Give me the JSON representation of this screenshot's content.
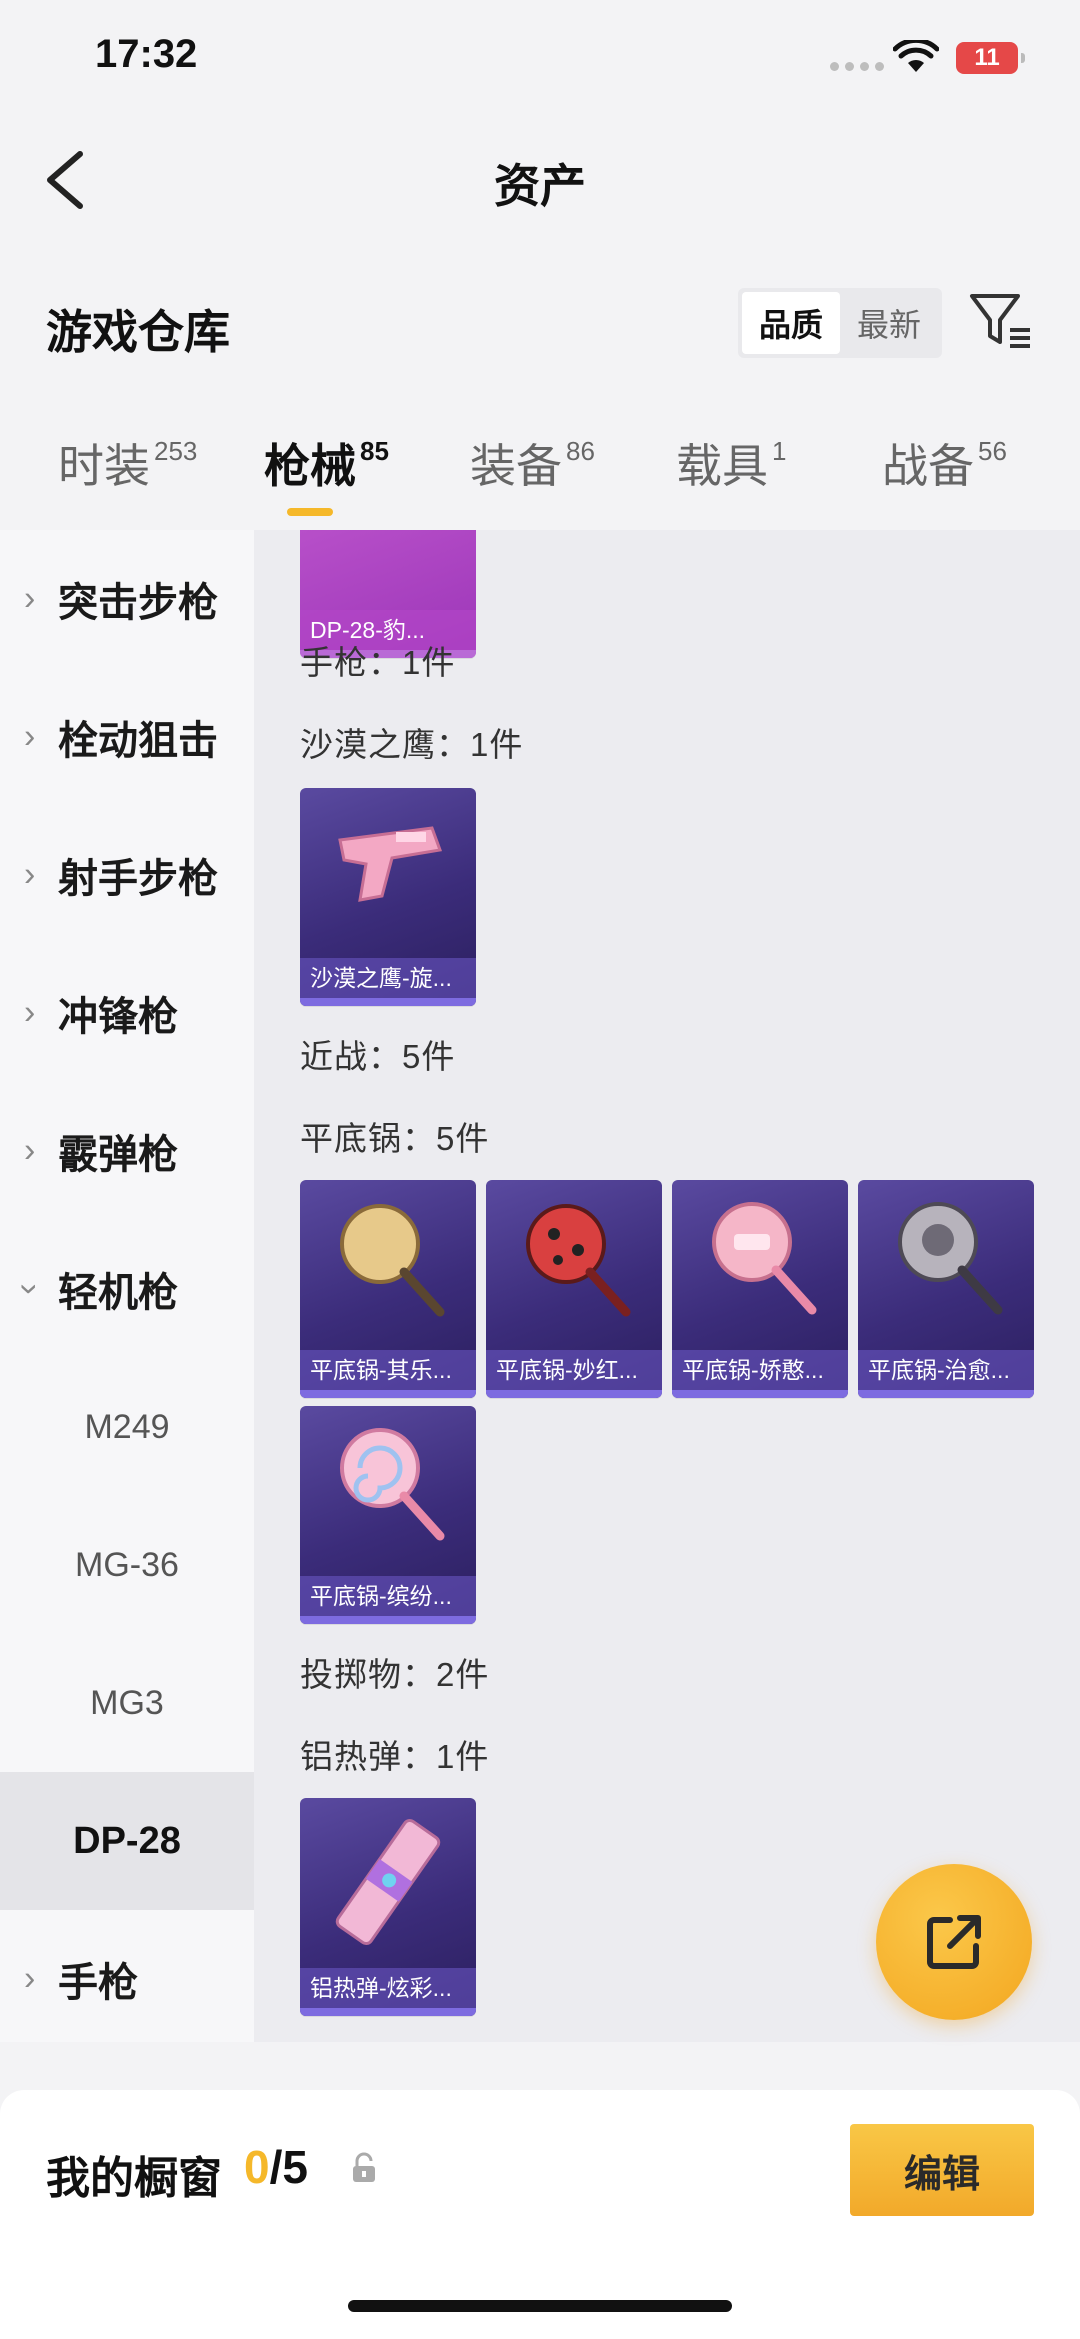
{
  "status": {
    "time": "17:32",
    "battery": "11"
  },
  "nav": {
    "title": "资产"
  },
  "warehouse": {
    "title": "游戏仓库",
    "sort_options": [
      "品质",
      "最新"
    ],
    "sort_selected": "品质"
  },
  "tabs": [
    {
      "label": "时装",
      "count": "253"
    },
    {
      "label": "枪械",
      "count": "85"
    },
    {
      "label": "装备",
      "count": "86"
    },
    {
      "label": "载具",
      "count": "1"
    },
    {
      "label": "战备",
      "count": "56"
    }
  ],
  "active_tab": "枪械",
  "sidebar": {
    "categories": [
      "突击步枪",
      "栓动狙击",
      "射手步枪",
      "冲锋枪",
      "霰弹枪",
      "轻机枪"
    ],
    "subitems": [
      "M249",
      "MG-36",
      "MG3",
      "DP-28"
    ],
    "selected_sub": "DP-28",
    "last_category": "手枪"
  },
  "content": {
    "top_card": "DP-28-豹...",
    "pistol_group": "手枪：1件",
    "deagle_group": "沙漠之鹰：1件",
    "deagle_card": "沙漠之鹰-旋...",
    "melee_group": "近战：5件",
    "pan_group": "平底锅：5件",
    "pan_cards": [
      "平底锅-其乐...",
      "平底锅-妙红...",
      "平底锅-娇憨...",
      "平底锅-治愈...",
      "平底锅-缤纷..."
    ],
    "throw_group": "投掷物：2件",
    "thermite_group": "铝热弹：1件",
    "thermite_card": "铝热弹-炫彩..."
  },
  "showcase": {
    "label": "我的橱窗",
    "current": "0",
    "total": "/5"
  },
  "edit_label": "编辑",
  "colors": {
    "accent": "#f5b82a",
    "card": "#3b2c7a",
    "card_pink": "#9c36b8"
  }
}
